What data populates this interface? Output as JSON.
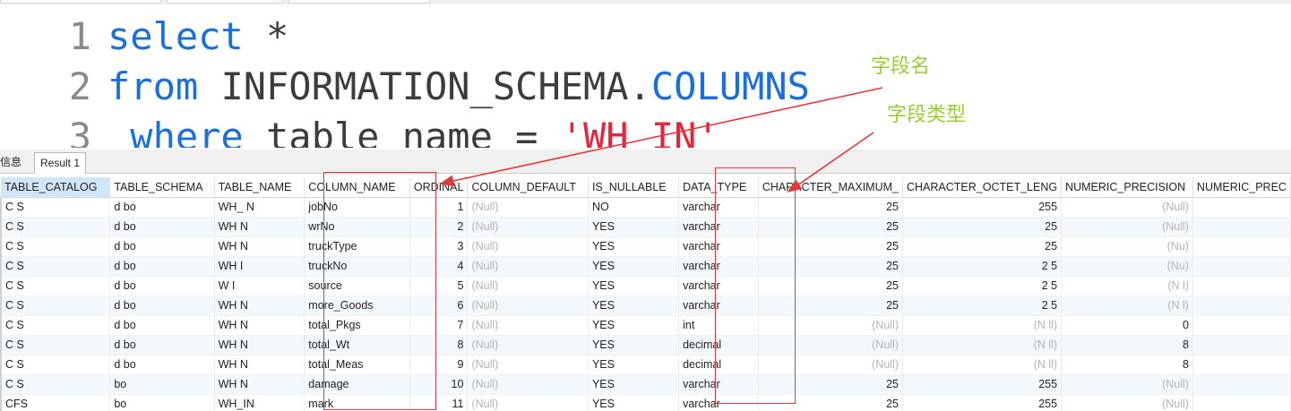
{
  "editor": {
    "lines": [
      {
        "num": "1",
        "tokens": [
          {
            "t": "select",
            "c": "kw"
          },
          {
            "t": " *",
            "c": "plain"
          }
        ]
      },
      {
        "num": "2",
        "tokens": [
          {
            "t": "from",
            "c": "kw"
          },
          {
            "t": " INFORMATION_SCHEMA.",
            "c": "plain"
          },
          {
            "t": "COLUMNS",
            "c": "kw"
          }
        ]
      },
      {
        "num": "3",
        "tokens": [
          {
            "t": " where",
            "c": "kw"
          },
          {
            "t": " table_name = ",
            "c": "plain"
          },
          {
            "t": "'WH_IN'",
            "c": "str"
          }
        ]
      }
    ]
  },
  "annotations": {
    "field_name": "字段名",
    "field_type": "字段类型"
  },
  "tabs": {
    "info": "信息",
    "result": "Result 1"
  },
  "colors": {
    "keyword": "#1a6fe0",
    "string": "#e8243c",
    "annotation": "#9acd32",
    "arrow": "#e0393e",
    "selected_header": "#cfe6f8"
  },
  "grid": {
    "columns": [
      "TABLE_CATALOG",
      "TABLE_SCHEMA",
      "TABLE_NAME",
      "COLUMN_NAME",
      "ORDINAL",
      "COLUMN_DEFAULT",
      "IS_NULLABLE",
      "DATA_TYPE",
      "CHARACTER_MAXIMUM_",
      "CHARACTER_OCTET_LENG",
      "NUMERIC_PRECISION",
      "NUMERIC_PREC"
    ],
    "rows": [
      [
        "C S",
        "d bo",
        "WH_ N",
        "jobNo",
        "1",
        "(Null)",
        "NO",
        "varchar",
        "25",
        "255",
        "(Null)",
        ""
      ],
      [
        "C S",
        "d bo",
        "WH N",
        "wrNo",
        "2",
        "(Null)",
        "YES",
        "varchar",
        "25",
        "25",
        "(Null)",
        ""
      ],
      [
        "C S",
        "d bo",
        "WH N",
        "truckType",
        "3",
        "(Null)",
        "YES",
        "varchar",
        "25",
        "25",
        "(Nu)",
        ""
      ],
      [
        "C S",
        "d bo",
        "WH I",
        "truckNo",
        "4",
        "(Null)",
        "YES",
        "varchar",
        "25",
        "2 5",
        "(Nu)",
        ""
      ],
      [
        "C S",
        "d bo",
        "W I",
        "source",
        "5",
        "(Null)",
        "YES",
        "varchar",
        "25",
        "2 5",
        "(N l)",
        ""
      ],
      [
        "C S",
        "d bo",
        "WH N",
        "more_Goods",
        "6",
        "(Null)",
        "YES",
        "varchar",
        "25",
        "2 5",
        "(N l)",
        ""
      ],
      [
        "C S",
        "d bo",
        "WH N",
        "total_Pkgs",
        "7",
        "(Null)",
        "YES",
        "int",
        "(Null)",
        "(N ll)",
        "0",
        ""
      ],
      [
        "C S",
        "d bo",
        "WH N",
        "total_Wt",
        "8",
        "(Null)",
        "YES",
        "decimal",
        "(Null)",
        "(N ll)",
        "8",
        ""
      ],
      [
        "C S",
        "d bo",
        "WH N",
        "total_Meas",
        "9",
        "(Null)",
        "YES",
        "decimal",
        "(Null)",
        "(N ll)",
        "8",
        ""
      ],
      [
        "C S",
        "bo",
        "WH N",
        "damage",
        "10",
        "(Null)",
        "YES",
        "varchar",
        "25",
        "255",
        "(Null)",
        ""
      ],
      [
        "CFS",
        "bo",
        "WH_IN",
        "mark",
        "11",
        "(Null)",
        "YES",
        "varchar",
        "25",
        "255",
        "(Null)",
        ""
      ]
    ]
  }
}
